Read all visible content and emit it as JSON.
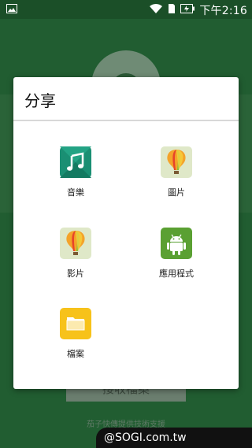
{
  "status_bar": {
    "time": "下午2:16"
  },
  "background_app": {
    "primary_button_label": "接收檔案",
    "footer_text": "茄子快傳提供技術支援"
  },
  "dialog": {
    "title": "分享",
    "apps": [
      {
        "label": "音樂",
        "icon": "music-icon"
      },
      {
        "label": "圖片",
        "icon": "balloon-icon"
      },
      {
        "label": "影片",
        "icon": "balloon-icon"
      },
      {
        "label": "應用程式",
        "icon": "android-icon"
      },
      {
        "label": "檔案",
        "icon": "folder-icon"
      }
    ]
  },
  "watermark": "@SOGI.com.tw",
  "colors": {
    "music_green": "#1a8f73",
    "android_green": "#5aa032",
    "folder_yellow": "#f7c21a",
    "balloon_bg": "#dfe8c8"
  }
}
